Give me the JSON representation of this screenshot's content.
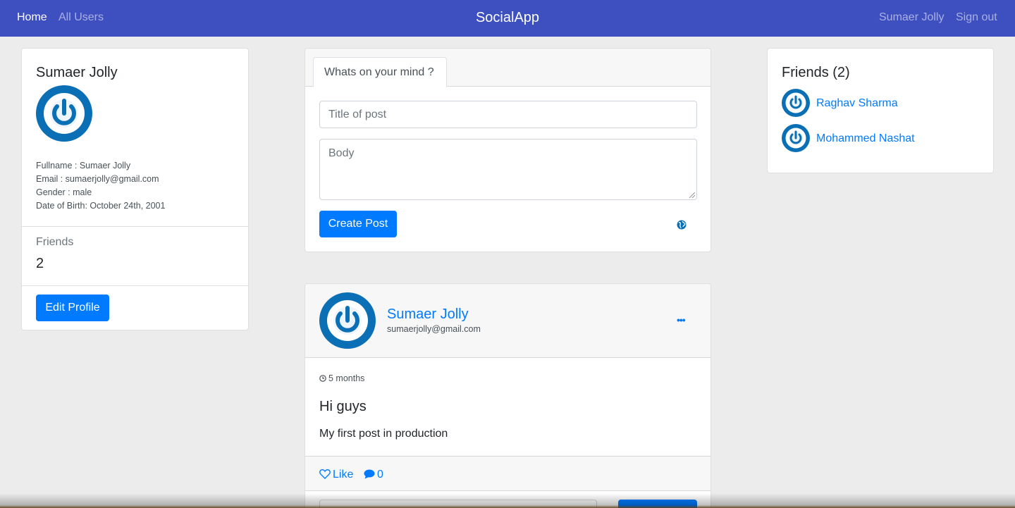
{
  "nav": {
    "home": "Home",
    "all_users": "All Users",
    "brand": "SocialApp",
    "user": "Sumaer Jolly",
    "sign_out": "Sign out"
  },
  "profile": {
    "name": "Sumaer Jolly",
    "fullname": "Fullname : Sumaer Jolly",
    "email": "Email : sumaerjolly@gmail.com",
    "gender": "Gender : male",
    "dob": "Date of Birth: October 24th, 2001",
    "friends_label": "Friends",
    "friends_count": "2",
    "edit_label": "Edit Profile"
  },
  "create_post": {
    "tab_label": "Whats on your mind ?",
    "title_placeholder": "Title of post",
    "body_placeholder": "Body",
    "submit_label": "Create Post"
  },
  "post": {
    "author": "Sumaer Jolly",
    "author_email": "sumaerjolly@gmail.com",
    "time": "5 months",
    "title": "Hi guys",
    "body": "My first post in production",
    "like_label": "Like",
    "comment_count": "0"
  },
  "friends_panel": {
    "title": "Friends (2)",
    "items": [
      {
        "name": "Raghav Sharma"
      },
      {
        "name": "Mohammed Nashat"
      }
    ]
  },
  "colors": {
    "navbar": "#3e4fbf",
    "primary": "#007bff",
    "avatar_blue": "#0a6fb5"
  }
}
